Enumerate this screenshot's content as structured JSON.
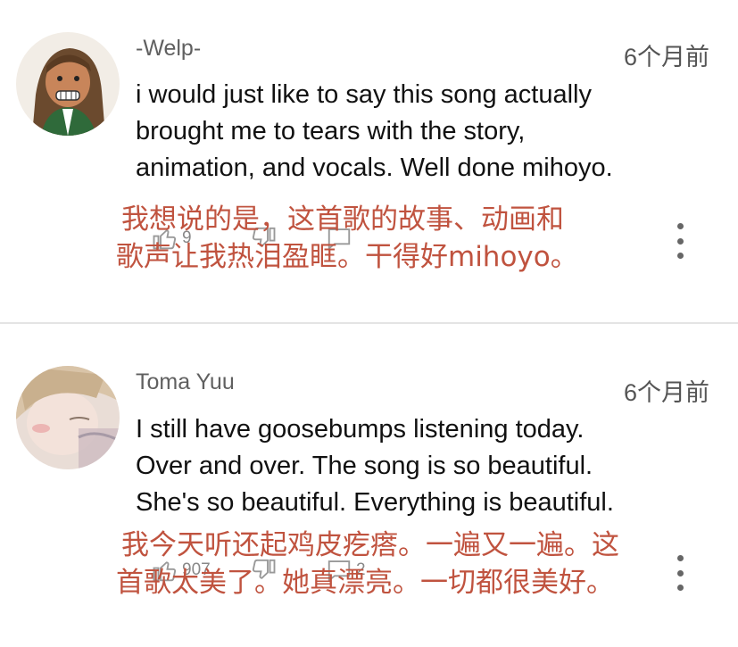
{
  "comments": [
    {
      "author": "-Welp-",
      "time": "6个月前",
      "text_lines": [
        "i would just like to say this song actually",
        "brought me to tears with the story,",
        "animation, and vocals. Well done mihoyo."
      ],
      "likes": "9",
      "replies": "",
      "translation_lines": [
        "我想说的是，这首歌的故事、动画和",
        "歌声让我热泪盈眶。干得好mihoyo。"
      ]
    },
    {
      "author": "Toma Yuu",
      "time": "6个月前",
      "text_lines": [
        "I still have goosebumps listening today.",
        "Over and over. The song is so beautiful.",
        "She's so beautiful. Everything is beautiful."
      ],
      "likes": "907",
      "replies": "2",
      "translation_lines": [
        "我今天听还起鸡皮疙瘩。一遍又一遍。这",
        "首歌太美了。她真漂亮。一切都很美好。"
      ]
    }
  ],
  "colors": {
    "translation": "#c0533f",
    "author": "#606060",
    "meta": "#888888",
    "divider": "#e4e4e4"
  },
  "icons": [
    "thumbs-up-icon",
    "thumbs-down-icon",
    "reply-icon",
    "more-vert-icon"
  ]
}
